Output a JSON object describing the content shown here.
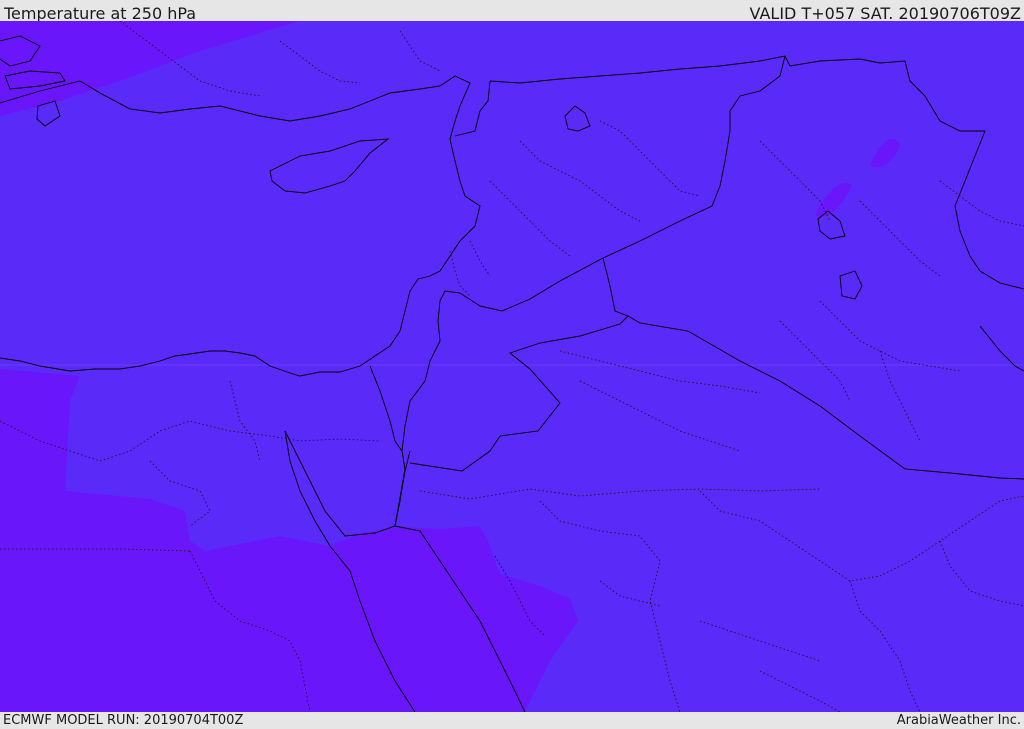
{
  "header": {
    "title": "Temperature at 250 hPa",
    "valid_time": "VALID T+057 SAT. 20190706T09Z"
  },
  "footer": {
    "model_run": "ECMWF MODEL RUN: 20190704T00Z",
    "credit": "ArabiaWeather Inc."
  },
  "map": {
    "colors": {
      "base_field": "#5a2af8",
      "colder_field": "#6a16fb",
      "borders": "#000000"
    }
  }
}
